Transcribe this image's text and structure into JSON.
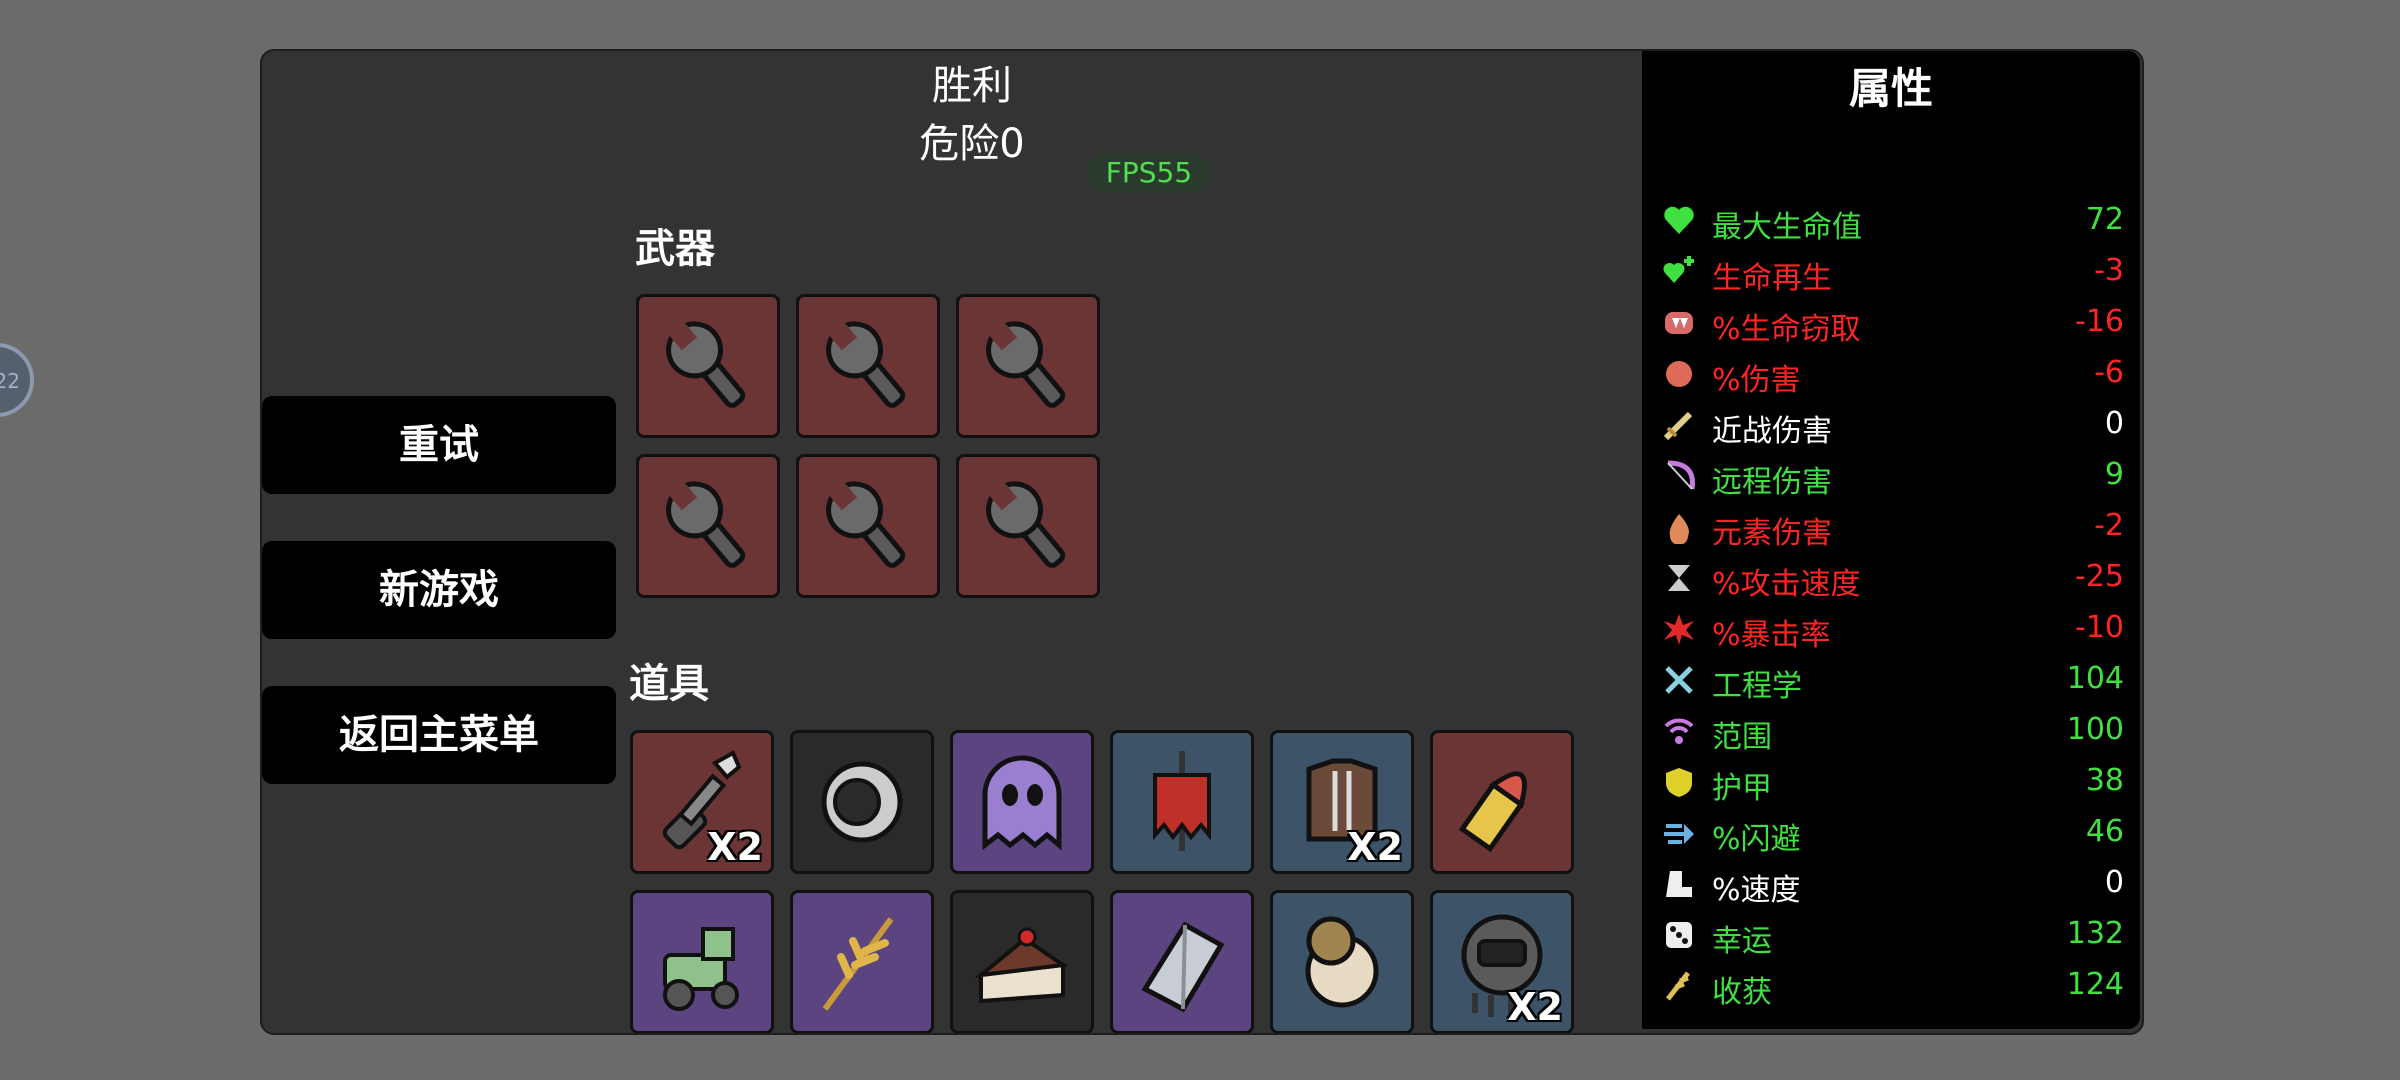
{
  "header": {
    "result": "胜利",
    "danger": "危险0",
    "fps": "FPS55"
  },
  "side_badge": "22",
  "menu": {
    "retry": "重试",
    "new_game": "新游戏",
    "main_menu": "返回主菜单"
  },
  "weapons": {
    "title": "武器",
    "slots": [
      {
        "icon": "wrench-icon"
      },
      {
        "icon": "wrench-icon"
      },
      {
        "icon": "wrench-icon"
      },
      {
        "icon": "wrench-icon"
      },
      {
        "icon": "wrench-icon"
      },
      {
        "icon": "wrench-icon"
      }
    ]
  },
  "items": {
    "title": "道具",
    "slots": [
      {
        "icon": "robot-arm-icon",
        "qty": "X2",
        "bg": "#6b3535"
      },
      {
        "icon": "ring-icon",
        "qty": "",
        "bg": "#2a2a2a"
      },
      {
        "icon": "ghost-icon",
        "qty": "",
        "bg": "#5c4480"
      },
      {
        "icon": "banner-icon",
        "qty": "",
        "bg": "#3c5368"
      },
      {
        "icon": "armor-vest-icon",
        "qty": "X2",
        "bg": "#3c5368"
      },
      {
        "icon": "bullet-icon",
        "qty": "",
        "bg": "#6b3535"
      },
      {
        "icon": "tractor-icon",
        "qty": "",
        "bg": "#5c4480"
      },
      {
        "icon": "wheat-icon",
        "qty": "",
        "bg": "#5c4480"
      },
      {
        "icon": "cake-icon",
        "qty": "",
        "bg": "#2a2a2a"
      },
      {
        "icon": "crystal-icon",
        "qty": "",
        "bg": "#5c4480"
      },
      {
        "icon": "compass-icon",
        "qty": "",
        "bg": "#3c5368"
      },
      {
        "icon": "diving-helmet-icon",
        "qty": "X2",
        "bg": "#3c5368"
      }
    ]
  },
  "stats": {
    "title": "属性",
    "rows": [
      {
        "name": "最大生命值",
        "value": "72",
        "color": "#3fe03f",
        "icon": "heart-icon"
      },
      {
        "name": "生命再生",
        "value": "-3",
        "color": "#ff2424",
        "icon": "regen-icon"
      },
      {
        "name": "%生命窃取",
        "value": "-16",
        "color": "#ff2424",
        "icon": "fang-icon"
      },
      {
        "name": "%伤害",
        "value": "-6",
        "color": "#ff2424",
        "icon": "fist-icon"
      },
      {
        "name": "近战伤害",
        "value": "0",
        "color": "#ffffff",
        "icon": "sword-icon"
      },
      {
        "name": "远程伤害",
        "value": "9",
        "color": "#3fe03f",
        "icon": "bow-icon"
      },
      {
        "name": "元素伤害",
        "value": "-2",
        "color": "#ff2424",
        "icon": "flame-icon"
      },
      {
        "name": "%攻击速度",
        "value": "-25",
        "color": "#ff2424",
        "icon": "hourglass-icon"
      },
      {
        "name": "%暴击率",
        "value": "-10",
        "color": "#ff2424",
        "icon": "crit-icon"
      },
      {
        "name": "工程学",
        "value": "104",
        "color": "#3fe03f",
        "icon": "tools-icon"
      },
      {
        "name": "范围",
        "value": "100",
        "color": "#3fe03f",
        "icon": "range-icon"
      },
      {
        "name": "护甲",
        "value": "38",
        "color": "#3fe03f",
        "icon": "shield-icon"
      },
      {
        "name": "%闪避",
        "value": "46",
        "color": "#3fe03f",
        "icon": "dodge-icon"
      },
      {
        "name": "%速度",
        "value": "0",
        "color": "#ffffff",
        "icon": "boot-icon"
      },
      {
        "name": "幸运",
        "value": "132",
        "color": "#3fe03f",
        "icon": "dice-icon"
      },
      {
        "name": "收获",
        "value": "124",
        "color": "#3fe03f",
        "icon": "harvest-icon"
      }
    ]
  }
}
